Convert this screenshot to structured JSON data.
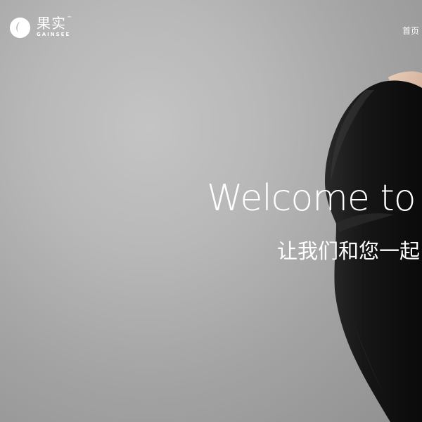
{
  "brand": {
    "name_cn": "果实",
    "name_en": "GAINSEE",
    "trademark": "™"
  },
  "nav": {
    "home": "首页"
  },
  "hero": {
    "headline": "Welcome to",
    "subline": "让我们和您一起"
  },
  "icons": {
    "logo": "fruit-logo-icon"
  },
  "colors": {
    "text": "#ffffff",
    "background": "#b5b5b5",
    "figure": "#111111"
  }
}
